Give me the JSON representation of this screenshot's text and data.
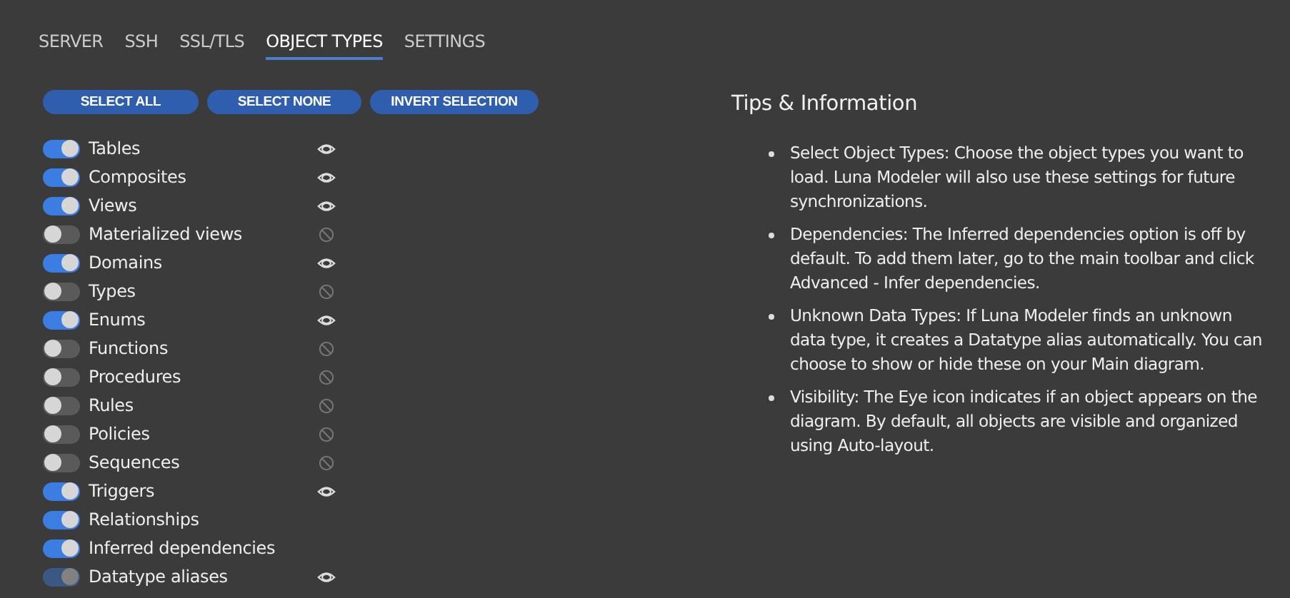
{
  "tabs": [
    {
      "label": "SERVER",
      "selected": false
    },
    {
      "label": "SSH",
      "selected": false
    },
    {
      "label": "SSL/TLS",
      "selected": false
    },
    {
      "label": "OBJECT TYPES",
      "selected": true
    },
    {
      "label": "SETTINGS",
      "selected": false
    }
  ],
  "buttons": [
    "SELECT ALL",
    "SELECT NONE",
    "INVERT SELECTION"
  ],
  "object_types": [
    {
      "label": "Tables",
      "on": true,
      "disabled": false,
      "visible": true
    },
    {
      "label": "Composites",
      "on": true,
      "disabled": false,
      "visible": true
    },
    {
      "label": "Views",
      "on": true,
      "disabled": false,
      "visible": true
    },
    {
      "label": "Materialized views",
      "on": false,
      "disabled": false,
      "visible": false
    },
    {
      "label": "Domains",
      "on": true,
      "disabled": false,
      "visible": true
    },
    {
      "label": "Types",
      "on": false,
      "disabled": false,
      "visible": false
    },
    {
      "label": "Enums",
      "on": true,
      "disabled": false,
      "visible": true
    },
    {
      "label": "Functions",
      "on": false,
      "disabled": false,
      "visible": false
    },
    {
      "label": "Procedures",
      "on": false,
      "disabled": false,
      "visible": false
    },
    {
      "label": "Rules",
      "on": false,
      "disabled": false,
      "visible": false
    },
    {
      "label": "Policies",
      "on": false,
      "disabled": false,
      "visible": false
    },
    {
      "label": "Sequences",
      "on": false,
      "disabled": false,
      "visible": false
    },
    {
      "label": "Triggers",
      "on": true,
      "disabled": false,
      "visible": true
    },
    {
      "label": "Relationships",
      "on": true,
      "disabled": false
    },
    {
      "label": "Inferred dependencies",
      "on": true,
      "disabled": false
    },
    {
      "label": "Datatype aliases",
      "on": true,
      "disabled": true,
      "visible": true
    }
  ],
  "tips": {
    "title": "Tips & Information",
    "items": [
      "Select Object Types: Choose the object types you want to load. Luna Modeler will also use these settings for future synchronizations.",
      "Dependencies: The Inferred dependencies option is off by default. To add them later, go to the main toolbar and click Advanced - Infer dependencies.",
      "Unknown Data Types: If Luna Modeler finds an unknown data type, it creates a Datatype alias automatically. You can choose to show or hide these on your Main diagram.",
      "Visibility: The Eye icon indicates if an object appears on the diagram. By default, all objects are visible and organized using Auto-layout."
    ]
  }
}
